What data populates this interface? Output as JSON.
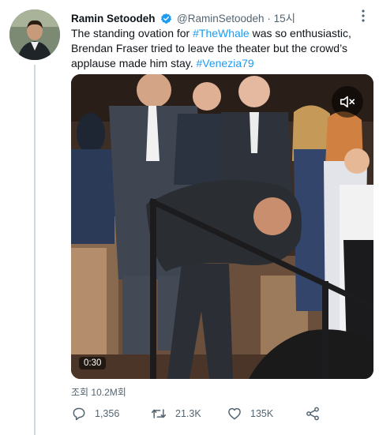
{
  "tweet": {
    "author_name": "Ramin Setoodeh",
    "handle": "@RaminSetoodeh",
    "separator": "·",
    "time": "15시",
    "text_part1": "The standing ovation for ",
    "hashtag1": "#TheWhale",
    "text_part2": " was so enthusiastic, Brendan Fraser tried to leave the theater but the crowd’s applause made him stay. ",
    "hashtag2": "#Venezia79"
  },
  "media": {
    "duration": "0:30"
  },
  "stats": {
    "views": "조회 10.2M회",
    "replies": "1,356",
    "retweets": "21.3K",
    "likes": "135K"
  },
  "icons": {
    "verified": "verified-badge-icon",
    "more": "more-options-icon",
    "mute": "muted-speaker-icon",
    "reply": "reply-icon",
    "retweet": "retweet-icon",
    "like": "heart-icon",
    "share": "share-icon"
  },
  "colors": {
    "accent": "#1d9bf0",
    "muted_text": "#536471",
    "thread_line": "#cfd9de"
  }
}
